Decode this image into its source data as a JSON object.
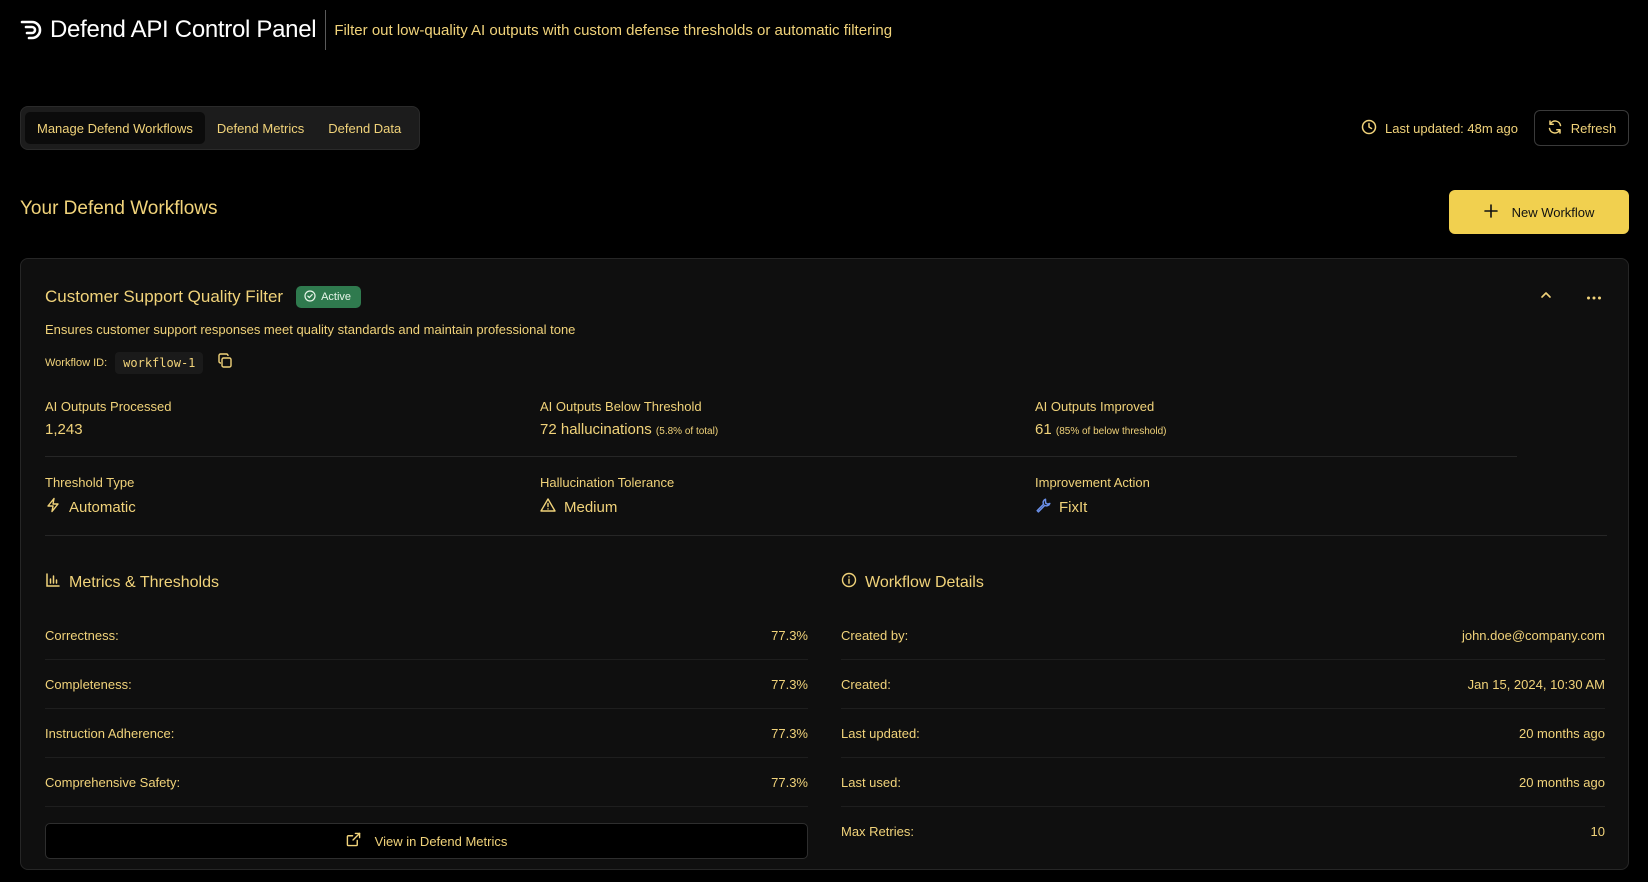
{
  "header": {
    "title": "Defend API Control Panel",
    "subtitle": "Filter out low-quality AI outputs with custom defense thresholds or automatic filtering"
  },
  "tabs": [
    {
      "label": "Manage Defend Workflows",
      "active": true
    },
    {
      "label": "Defend Metrics",
      "active": false
    },
    {
      "label": "Defend Data",
      "active": false
    }
  ],
  "toolbar": {
    "last_updated": "Last updated: 48m ago",
    "refresh_label": "Refresh"
  },
  "section": {
    "title": "Your Defend Workflows",
    "new_workflow_label": "New Workflow"
  },
  "workflow": {
    "name": "Customer Support Quality Filter",
    "status": "Active",
    "description": "Ensures customer support responses meet quality standards and maintain professional tone",
    "id_label": "Workflow ID:",
    "id": "workflow-1",
    "stats": {
      "processed_label": "AI Outputs Processed",
      "processed_value": "1,243",
      "below_label": "AI Outputs Below Threshold",
      "below_value": "72 hallucinations",
      "below_note": "(5.8% of total)",
      "improved_label": "AI Outputs Improved",
      "improved_value": "61",
      "improved_note": "(85% of below threshold)"
    },
    "config": {
      "threshold_type_label": "Threshold Type",
      "threshold_type": "Automatic",
      "tolerance_label": "Hallucination Tolerance",
      "tolerance": "Medium",
      "action_label": "Improvement Action",
      "action": "FixIt"
    },
    "metrics": {
      "title": "Metrics & Thresholds",
      "rows": [
        {
          "label": "Correctness:",
          "value": "77.3%"
        },
        {
          "label": "Completeness:",
          "value": "77.3%"
        },
        {
          "label": "Instruction Adherence:",
          "value": "77.3%"
        },
        {
          "label": "Comprehensive Safety:",
          "value": "77.3%"
        }
      ],
      "view_label": "View in Defend Metrics"
    },
    "details": {
      "title": "Workflow Details",
      "rows": [
        {
          "label": "Created by:",
          "value": "john.doe@company.com"
        },
        {
          "label": "Created:",
          "value": "Jan 15, 2024, 10:30 AM"
        },
        {
          "label": "Last updated:",
          "value": "20 months ago"
        },
        {
          "label": "Last used:",
          "value": "20 months ago"
        },
        {
          "label": "Max Retries:",
          "value": "10"
        }
      ]
    }
  },
  "colors": {
    "accent": "#f1d37a",
    "button": "#f1d04f",
    "active_badge": "#2f7a4e",
    "background": "#000000"
  }
}
